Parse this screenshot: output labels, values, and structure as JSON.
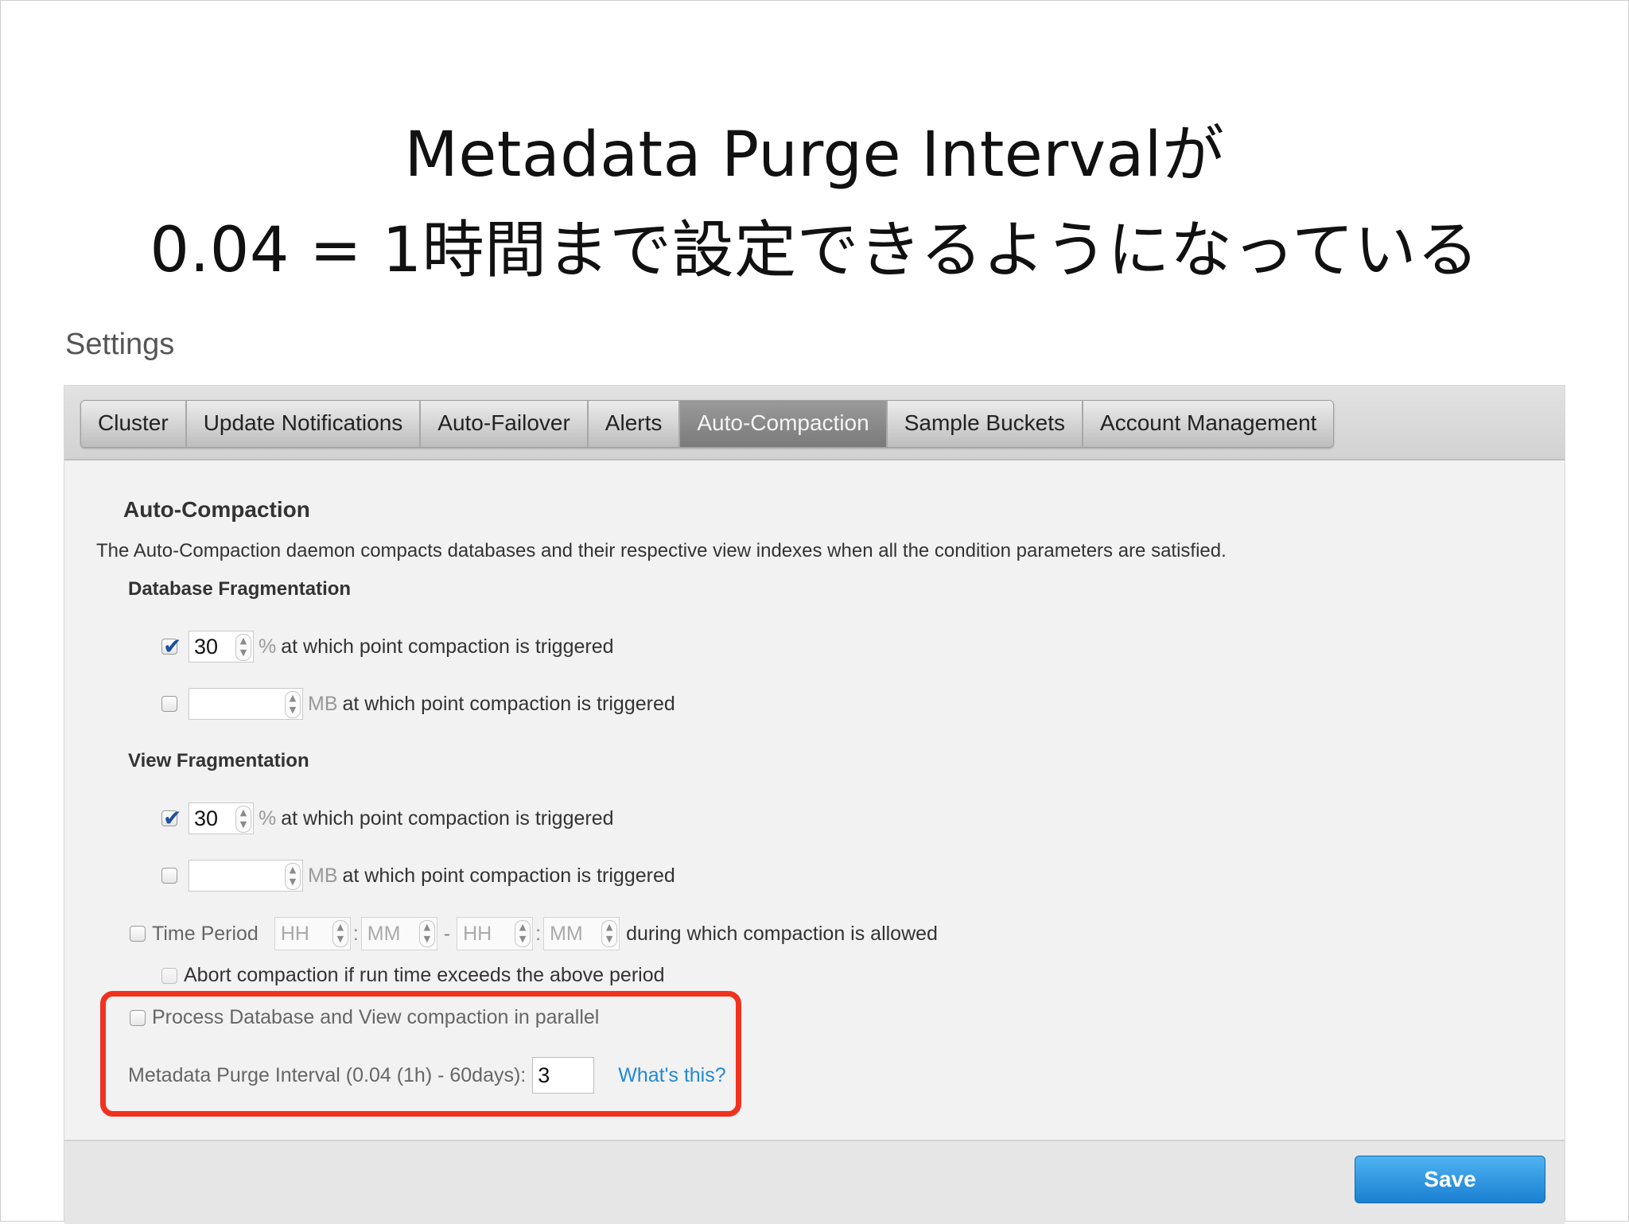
{
  "slide": {
    "title_line1": "Metadata Purge Intervalが",
    "title_line2": "0.04 = 1時間まで設定できるようになっている"
  },
  "page": {
    "heading": "Settings"
  },
  "tabs": [
    {
      "label": "Cluster",
      "active": false
    },
    {
      "label": "Update Notifications",
      "active": false
    },
    {
      "label": "Auto-Failover",
      "active": false
    },
    {
      "label": "Alerts",
      "active": false
    },
    {
      "label": "Auto-Compaction",
      "active": true
    },
    {
      "label": "Sample Buckets",
      "active": false
    },
    {
      "label": "Account Management",
      "active": false
    }
  ],
  "autocompaction": {
    "title": "Auto-Compaction",
    "description": "The Auto-Compaction daemon compacts databases and their respective view indexes when all the condition parameters are satisfied.",
    "database_fragmentation": {
      "title": "Database Fragmentation",
      "percent_checked": true,
      "percent_value": "30",
      "percent_unit": "%",
      "percent_label": "at which point compaction is triggered",
      "mb_checked": false,
      "mb_value": "",
      "mb_unit": "MB",
      "mb_label": "at which point compaction is triggered"
    },
    "view_fragmentation": {
      "title": "View Fragmentation",
      "percent_checked": true,
      "percent_value": "30",
      "percent_unit": "%",
      "percent_label": "at which point compaction is triggered",
      "mb_checked": false,
      "mb_value": "",
      "mb_unit": "MB",
      "mb_label": "at which point compaction is triggered"
    },
    "time_period": {
      "label": "Time Period",
      "from_hour_placeholder": "HH",
      "from_minute_placeholder": "MM",
      "to_hour_placeholder": "HH",
      "to_minute_placeholder": "MM",
      "colon": ":",
      "dash": "-",
      "suffix": "during which compaction is allowed",
      "abort_label": "Abort compaction if run time exceeds the above period"
    },
    "parallel_label": "Process Database and View compaction in parallel",
    "purge": {
      "label": "Metadata Purge Interval (0.04 (1h) - 60days):",
      "value": "3",
      "help_link": "What's this?"
    }
  },
  "footer": {
    "save_label": "Save"
  },
  "colors": {
    "highlight": "#f0321e",
    "link": "#2189d4",
    "save_button": "#2a8fdc",
    "active_tab": "#8a8a8a"
  }
}
